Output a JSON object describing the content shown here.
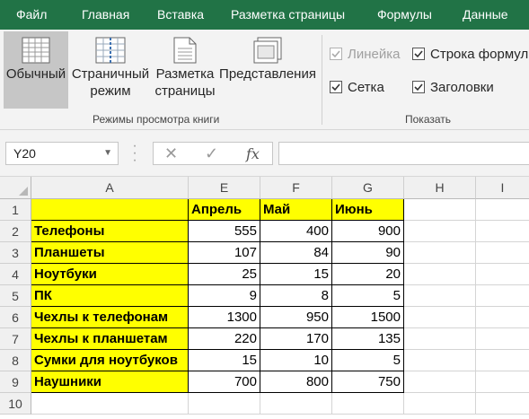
{
  "menu": {
    "tabs": [
      "Файл",
      "Главная",
      "Вставка",
      "Разметка страницы",
      "Формулы",
      "Данные"
    ]
  },
  "ribbon": {
    "views": [
      {
        "label1": "Обычный",
        "label2": "",
        "icon": "normal-view-icon",
        "active": true
      },
      {
        "label1": "Страничный",
        "label2": "режим",
        "icon": "page-break-view-icon",
        "active": false
      },
      {
        "label1": "Разметка",
        "label2": "страницы",
        "icon": "page-layout-view-icon",
        "active": false
      },
      {
        "label1": "Представления",
        "label2": "",
        "icon": "custom-views-icon",
        "active": false
      }
    ],
    "views_group_label": "Режимы просмотра книги",
    "show_group_label": "Показать",
    "checks": [
      {
        "label": "Линейка",
        "checked": true,
        "disabled": true
      },
      {
        "label": "Строка формул",
        "checked": true,
        "disabled": false
      },
      {
        "label": "Сетка",
        "checked": true,
        "disabled": false
      },
      {
        "label": "Заголовки",
        "checked": true,
        "disabled": false
      }
    ]
  },
  "formula_bar": {
    "name_box": "Y20",
    "cancel_symbol": "✕",
    "enter_symbol": "✓",
    "fx_symbol": "fx",
    "value": ""
  },
  "sheet": {
    "columns": [
      "A",
      "E",
      "F",
      "G",
      "H",
      "I"
    ],
    "row_numbers": [
      "1",
      "2",
      "3",
      "4",
      "5",
      "6",
      "7",
      "8",
      "9",
      "10"
    ],
    "rows": [
      [
        "",
        "Апрель",
        "Май",
        "Июнь"
      ],
      [
        "Телефоны",
        "555",
        "400",
        "900"
      ],
      [
        "Планшеты",
        "107",
        "84",
        "90"
      ],
      [
        "Ноутбуки",
        "25",
        "15",
        "20"
      ],
      [
        "ПК",
        "9",
        "8",
        "5"
      ],
      [
        "Чехлы к телефонам",
        "1300",
        "950",
        "1500"
      ],
      [
        "Чехлы к планшетам",
        "220",
        "170",
        "135"
      ],
      [
        "Сумки для ноутбуков",
        "15",
        "10",
        "5"
      ],
      [
        "Наушники",
        "700",
        "800",
        "750"
      ]
    ]
  },
  "colors": {
    "accent": "#217346",
    "highlight": "#ffff00"
  }
}
